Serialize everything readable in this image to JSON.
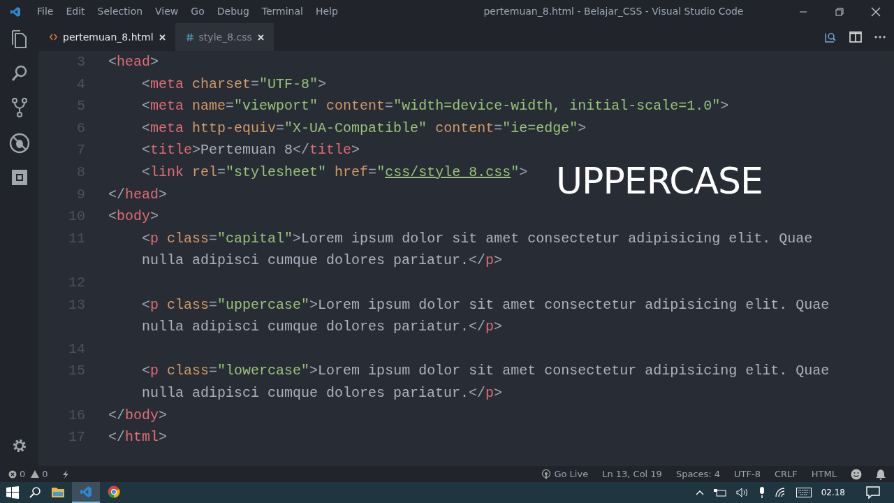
{
  "menu": [
    "File",
    "Edit",
    "Selection",
    "View",
    "Go",
    "Debug",
    "Terminal",
    "Help"
  ],
  "window": {
    "title": "pertemuan_8.html - Belajar_CSS - Visual Studio Code"
  },
  "tabs": [
    {
      "label": "pertemuan_8.html",
      "kind": "html",
      "selected": true
    },
    {
      "label": "style_8.css",
      "kind": "css",
      "selected": false
    }
  ],
  "code_lines": [
    {
      "number": "3",
      "tokens": [
        {
          "text": "<",
          "kind": "punct"
        },
        {
          "text": "head",
          "kind": "tag"
        },
        {
          "text": ">",
          "kind": "punct"
        }
      ],
      "children": [
        {
          "number": "4",
          "tokens": [
            {
              "text": "<",
              "kind": "punct"
            },
            {
              "text": "meta",
              "kind": "tag"
            },
            {
              "text": " charset",
              "kind": "attr"
            },
            {
              "text": "=",
              "kind": "punct"
            },
            {
              "text": "\"UTF-8\"",
              "kind": "str"
            },
            {
              "text": ">",
              "kind": "punct"
            }
          ]
        },
        {
          "number": "5",
          "tokens": [
            {
              "text": "<",
              "kind": "punct"
            },
            {
              "text": "meta",
              "kind": "tag"
            },
            {
              "text": " name",
              "kind": "attr"
            },
            {
              "text": "=",
              "kind": "punct"
            },
            {
              "text": "\"viewport\"",
              "kind": "str"
            },
            {
              "text": " content",
              "kind": "attr"
            },
            {
              "text": "=",
              "kind": "punct"
            },
            {
              "text": "\"width=device-width, initial-scale=1.0\"",
              "kind": "str"
            },
            {
              "text": ">",
              "kind": "punct"
            }
          ]
        },
        {
          "number": "6",
          "tokens": [
            {
              "text": "<",
              "kind": "punct"
            },
            {
              "text": "meta",
              "kind": "tag"
            },
            {
              "text": " http-equiv",
              "kind": "attr"
            },
            {
              "text": "=",
              "kind": "punct"
            },
            {
              "text": "\"X-UA-Compatible\"",
              "kind": "str"
            },
            {
              "text": " content",
              "kind": "attr"
            },
            {
              "text": "=",
              "kind": "punct"
            },
            {
              "text": "\"ie=edge\"",
              "kind": "str"
            },
            {
              "text": ">",
              "kind": "punct"
            }
          ]
        },
        {
          "number": "7",
          "tokens": [
            {
              "text": "<",
              "kind": "punct"
            },
            {
              "text": "title",
              "kind": "tag"
            },
            {
              "text": ">",
              "kind": "punct"
            },
            {
              "text": "Pertemuan 8",
              "kind": "plain"
            },
            {
              "text": "</",
              "kind": "punct"
            },
            {
              "text": "title",
              "kind": "tag"
            },
            {
              "text": ">",
              "kind": "punct"
            }
          ]
        },
        {
          "number": "8",
          "tokens": [
            {
              "text": "<",
              "kind": "punct"
            },
            {
              "text": "link",
              "kind": "tag"
            },
            {
              "text": " rel",
              "kind": "attr"
            },
            {
              "text": "=",
              "kind": "punct"
            },
            {
              "text": "\"stylesheet\"",
              "kind": "str"
            },
            {
              "text": " href",
              "kind": "attr"
            },
            {
              "text": "=",
              "kind": "punct"
            },
            {
              "text": "\"",
              "kind": "str"
            },
            {
              "text": "css/style_8.css",
              "kind": "link"
            },
            {
              "text": "\"",
              "kind": "str"
            },
            {
              "text": ">",
              "kind": "punct"
            }
          ]
        }
      ]
    },
    {
      "number": "9",
      "tokens": [
        {
          "text": "</",
          "kind": "punct"
        },
        {
          "text": "head",
          "kind": "tag"
        },
        {
          "text": ">",
          "kind": "punct"
        }
      ]
    },
    {
      "number": "10",
      "tokens": [
        {
          "text": "<",
          "kind": "punct"
        },
        {
          "text": "body",
          "kind": "tag"
        },
        {
          "text": ">",
          "kind": "punct"
        }
      ],
      "children": [
        {
          "number": "11",
          "tokens": [
            {
              "text": "<",
              "kind": "punct"
            },
            {
              "text": "p",
              "kind": "tag"
            },
            {
              "text": " class",
              "kind": "attr"
            },
            {
              "text": "=",
              "kind": "punct"
            },
            {
              "text": "\"capital\"",
              "kind": "str"
            },
            {
              "text": ">",
              "kind": "punct"
            },
            {
              "text": "Lorem ipsum dolor sit amet consectetur adipisicing elit. Quae",
              "kind": "plain"
            }
          ]
        },
        {
          "tokens": [
            {
              "text": "nulla adipisci cumque dolores pariatur.",
              "kind": "plain"
            },
            {
              "text": "</",
              "kind": "punct"
            },
            {
              "text": "p",
              "kind": "tag"
            },
            {
              "text": ">",
              "kind": "punct"
            }
          ]
        },
        {
          "number": "12"
        },
        {
          "number": "13",
          "tokens": [
            {
              "text": "<",
              "kind": "punct"
            },
            {
              "text": "p",
              "kind": "tag"
            },
            {
              "text": " class",
              "kind": "attr"
            },
            {
              "text": "=",
              "kind": "punct"
            },
            {
              "text": "\"uppercase\"",
              "kind": "str"
            },
            {
              "text": ">",
              "kind": "punct"
            },
            {
              "text": "Lorem ipsum dolor sit amet consectetur adipisicing elit. Quae",
              "kind": "plain"
            }
          ]
        },
        {
          "tokens": [
            {
              "text": "nulla adipisci cumque dolores pariatur.",
              "kind": "plain"
            },
            {
              "text": "</",
              "kind": "punct"
            },
            {
              "text": "p",
              "kind": "tag"
            },
            {
              "text": ">",
              "kind": "punct"
            }
          ]
        },
        {
          "number": "14"
        },
        {
          "number": "15",
          "tokens": [
            {
              "text": "<",
              "kind": "punct"
            },
            {
              "text": "p",
              "kind": "tag"
            },
            {
              "text": " class",
              "kind": "attr"
            },
            {
              "text": "=",
              "kind": "punct"
            },
            {
              "text": "\"lowercase\"",
              "kind": "str"
            },
            {
              "text": ">",
              "kind": "punct"
            },
            {
              "text": "Lorem ipsum dolor sit amet consectetur adipisicing elit. Quae",
              "kind": "plain"
            }
          ]
        },
        {
          "tokens": [
            {
              "text": "nulla adipisci cumque dolores pariatur.",
              "kind": "plain"
            },
            {
              "text": "</",
              "kind": "punct"
            },
            {
              "text": "p",
              "kind": "tag"
            },
            {
              "text": ">",
              "kind": "punct"
            }
          ]
        }
      ]
    },
    {
      "number": "16",
      "tokens": [
        {
          "text": "</",
          "kind": "punct"
        },
        {
          "text": "body",
          "kind": "tag"
        },
        {
          "text": ">",
          "kind": "punct"
        }
      ]
    },
    {
      "number": "17",
      "tokens": [
        {
          "text": "</",
          "kind": "punct"
        },
        {
          "text": "html",
          "kind": "tag"
        },
        {
          "text": ">",
          "kind": "punct"
        }
      ]
    }
  ],
  "overlay_caption": "UPPERCASE",
  "status_bar": {
    "errors": "0",
    "warnings": "0",
    "items": [
      "Go Live",
      "Ln 13, Col 19",
      "Spaces: 4",
      "UTF-8",
      "CRLF",
      "HTML"
    ]
  },
  "taskbar": {
    "clock": "02.18",
    "apps": [
      {
        "kind": "explorer",
        "selected": false
      },
      {
        "kind": "vscode",
        "selected": true
      },
      {
        "kind": "chrome",
        "selected": false
      }
    ]
  }
}
